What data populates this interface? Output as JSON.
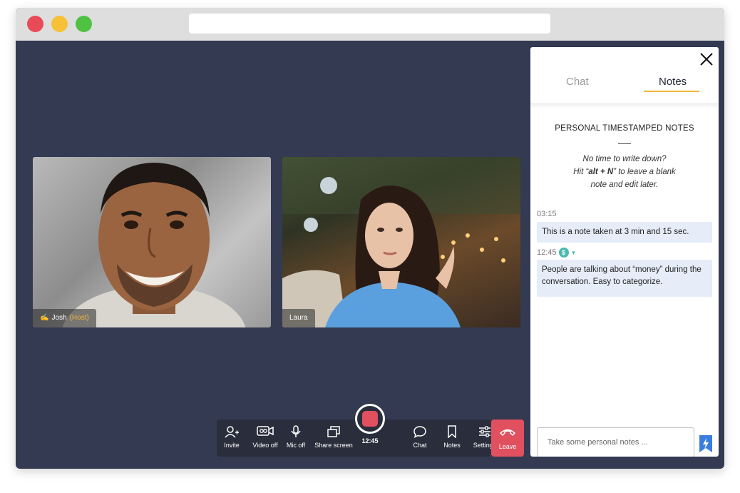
{
  "window": {
    "controls": [
      "close",
      "minimize",
      "maximize"
    ]
  },
  "participants": [
    {
      "name": "Josh",
      "role": "(Host)",
      "icon": "raised-hand-icon"
    },
    {
      "name": "Laura"
    }
  ],
  "toolbar": {
    "invite": "Invite",
    "video": "Video off",
    "mic": "Mic off",
    "share": "Share screen",
    "record_time": "12:45",
    "chat": "Chat",
    "notes": "Notes",
    "settings": "Settings",
    "leave": "Leave"
  },
  "panel": {
    "tabs": {
      "chat": "Chat",
      "notes": "Notes",
      "active": "Notes"
    },
    "heading": "PERSONAL TIMESTAMPED NOTES",
    "hint": {
      "line1": "No time to write down?",
      "line2_pre": "Hit “",
      "line2_key": "alt + N",
      "line2_post": "” to leave a blank",
      "line3": "note and edit later."
    },
    "notes": [
      {
        "time": "03:15",
        "text": "This is a note taken at 3 min and 15 sec."
      },
      {
        "time": "12:45",
        "tag": "$",
        "text": "People are talking about “money” during the conversation. Easy to categorize."
      }
    ],
    "input_placeholder": "Take some personal notes ..."
  },
  "colors": {
    "background": "#343a52",
    "accent": "#f2b640",
    "record": "#e0505e",
    "note_bg": "#e6ecf8",
    "tag": "#4bb9ad",
    "flash": "#3b7ddd"
  }
}
